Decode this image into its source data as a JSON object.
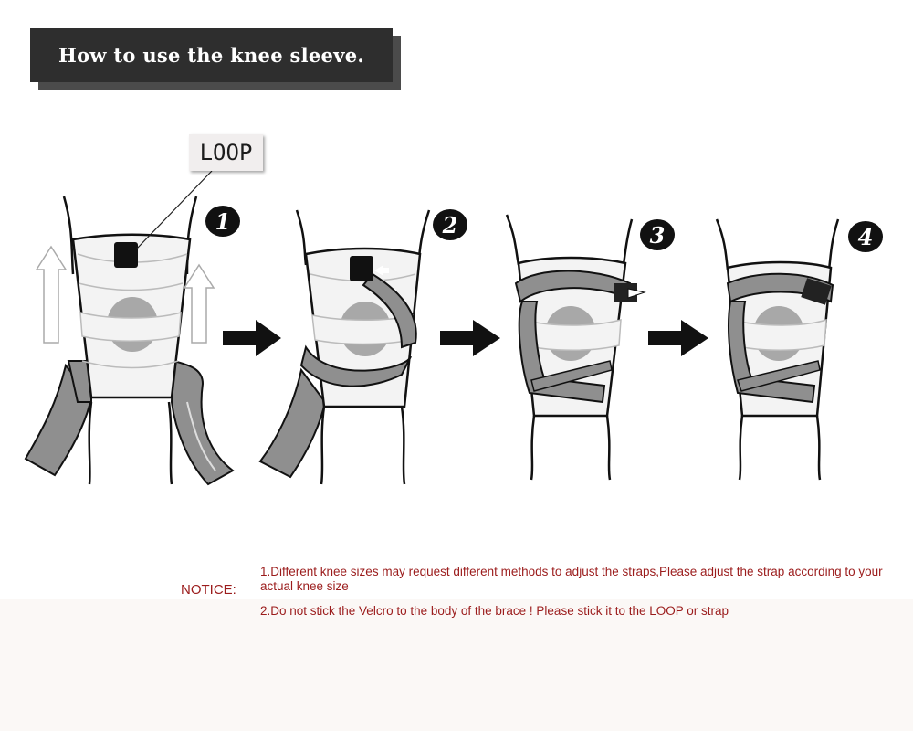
{
  "title": "How to use the knee sleeve.",
  "loop_label": "LOOP",
  "steps": [
    "1",
    "2",
    "3",
    "4"
  ],
  "notice": {
    "label": "NOTICE:",
    "items": [
      "1.Different knee sizes may request different methods to adjust the straps,Please adjust the strap according to your actual knee size",
      "2.Do not stick the Velcro to the body of the brace ! Please stick it to the LOOP or strap"
    ]
  },
  "colors": {
    "strap": "#8f8f8f",
    "sleeve": "#f3f3f3",
    "patch": "#a8a8a8",
    "notice_text": "#9b1c1c",
    "title_bg": "#2e2e2e"
  }
}
